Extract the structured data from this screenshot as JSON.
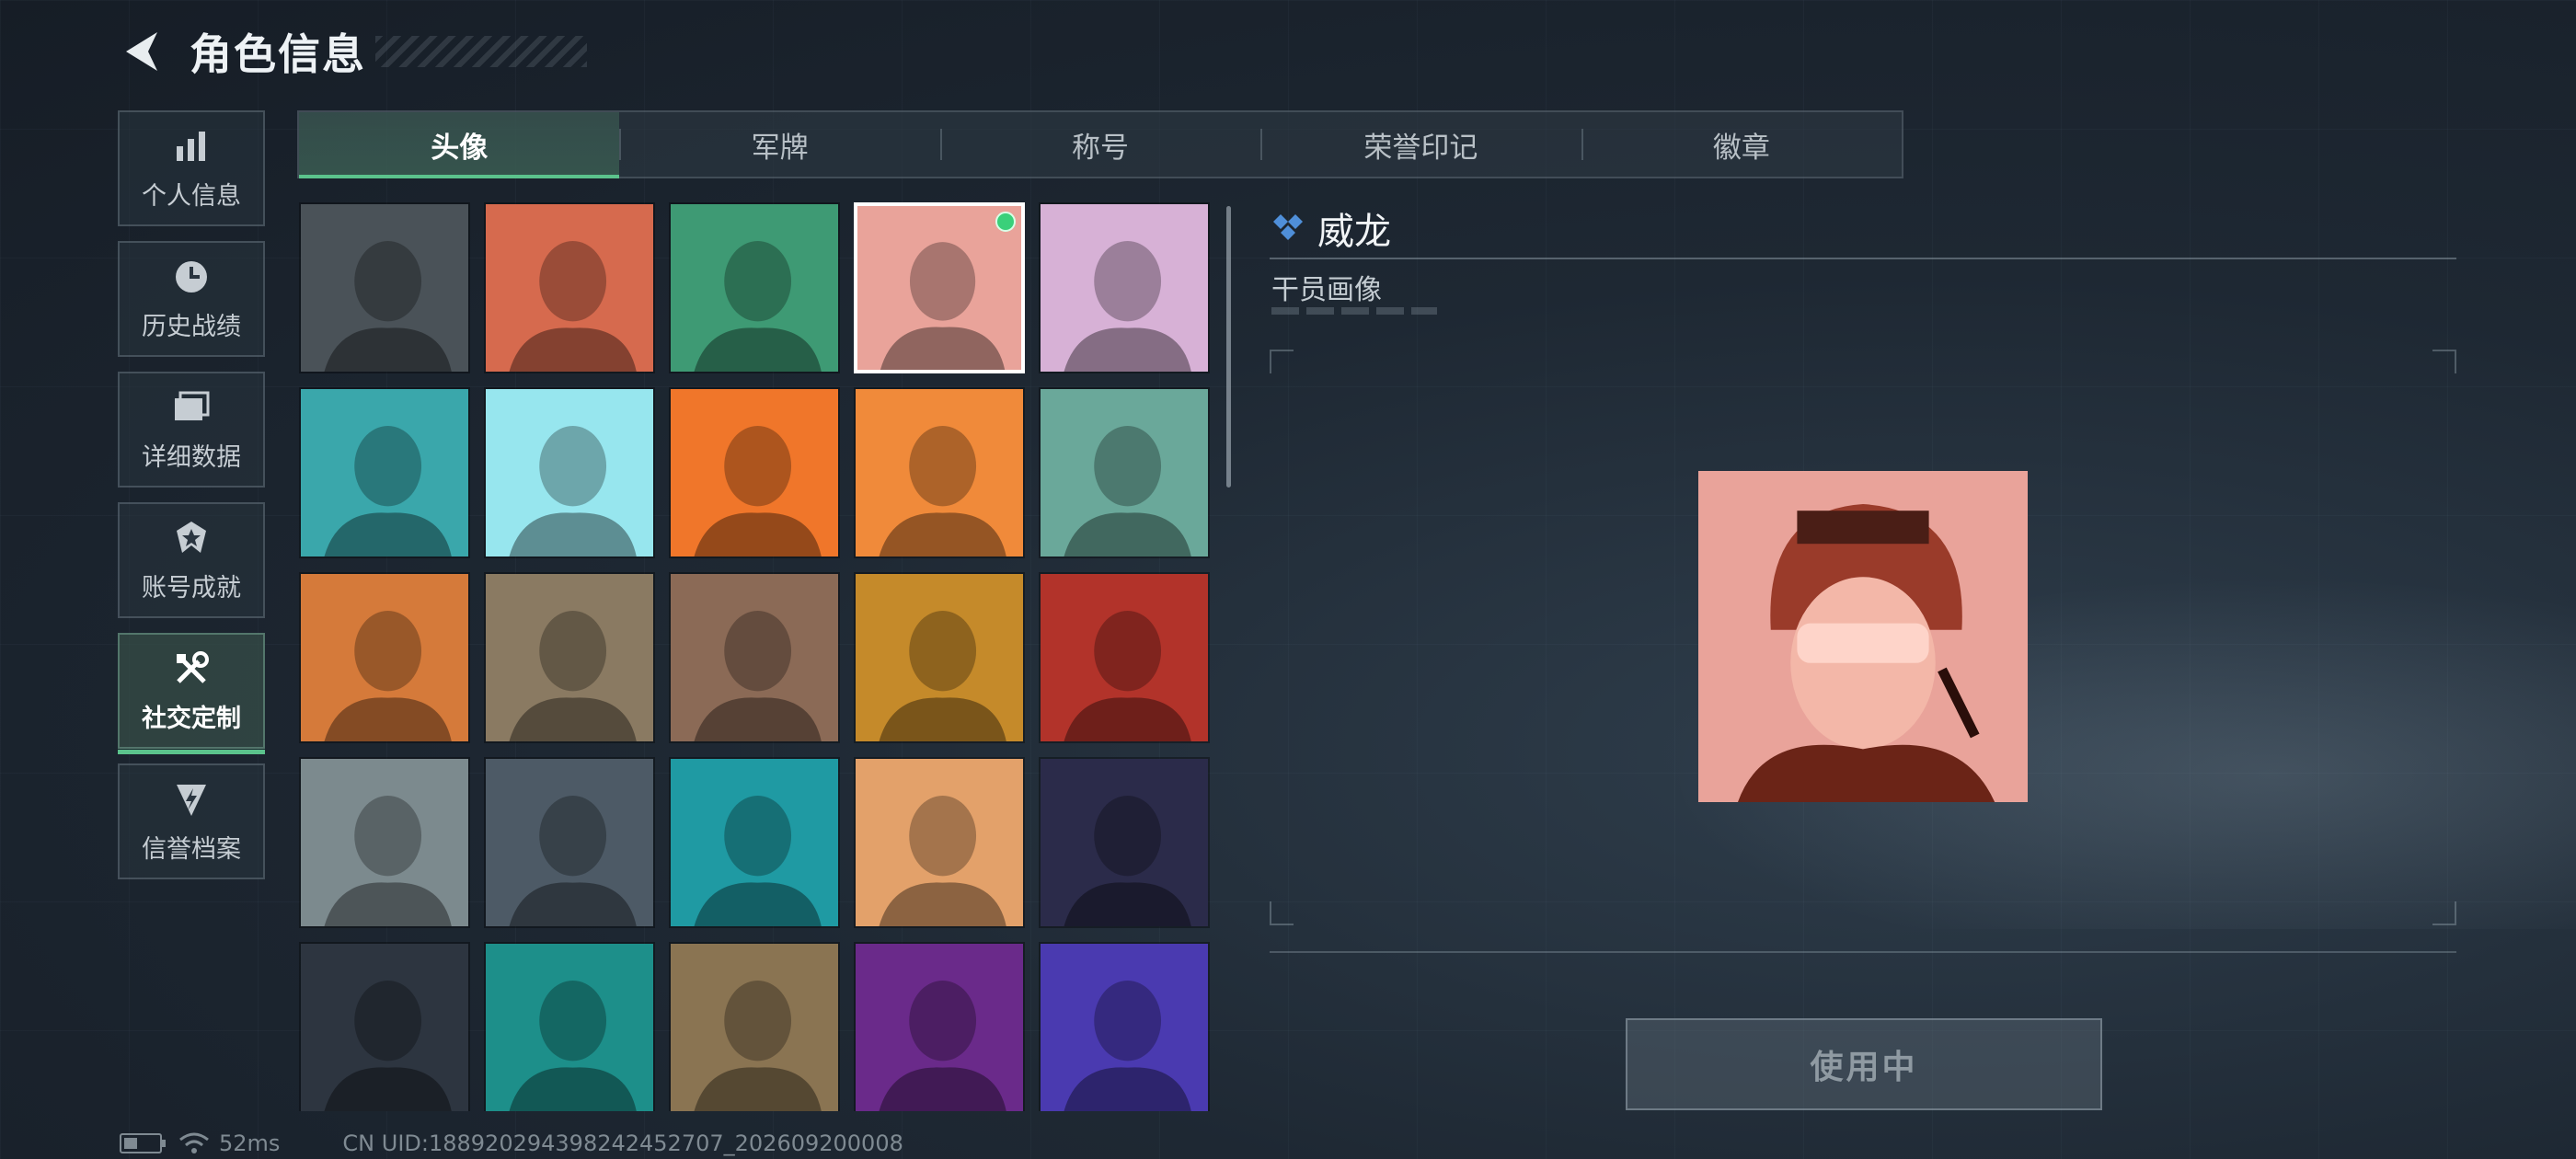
{
  "header": {
    "title": "角色信息"
  },
  "sidebar": {
    "items": [
      {
        "label": "个人信息",
        "icon": "bar-chart-icon",
        "active": false
      },
      {
        "label": "历史战绩",
        "icon": "clock-icon",
        "active": false
      },
      {
        "label": "详细数据",
        "icon": "folder-icon",
        "active": false
      },
      {
        "label": "账号成就",
        "icon": "badge-icon",
        "active": false
      },
      {
        "label": "社交定制",
        "icon": "tools-icon",
        "active": true
      },
      {
        "label": "信誉档案",
        "icon": "shield-icon",
        "active": false
      }
    ]
  },
  "tabs": [
    {
      "label": "头像",
      "active": true
    },
    {
      "label": "军牌",
      "active": false
    },
    {
      "label": "称号",
      "active": false
    },
    {
      "label": "荣誉印记",
      "active": false
    },
    {
      "label": "徽章",
      "active": false
    }
  ],
  "grid": {
    "selected_index": 3,
    "columns": 5,
    "avatar_colors": [
      "#4a5258",
      "#d66a4e",
      "#3e9a74",
      "#e9a39a",
      "#d7b1d6",
      "#3aa7ab",
      "#97e6ee",
      "#f0762a",
      "#f08a3a",
      "#6aa89a",
      "#d57a3a",
      "#8a7a62",
      "#8b6a56",
      "#c58a2a",
      "#b2332a",
      "#7c8a8e",
      "#4d5a66",
      "#1f9aa3",
      "#e3a16a",
      "#2b2b4a",
      "#2d3540",
      "#1d8f8a",
      "#8a7452",
      "#6a2a8a",
      "#4a3ab0"
    ]
  },
  "detail": {
    "name": "威龙",
    "type": "干员画像",
    "preview_bg": "#e9a39a",
    "button_label": "使用中"
  },
  "status_bar": {
    "ping": "52ms",
    "uid": "CN UID:18892029439824245​2707_202609200008"
  },
  "colors": {
    "accent": "#5bc38c",
    "selected_dot": "#3ad07a"
  }
}
